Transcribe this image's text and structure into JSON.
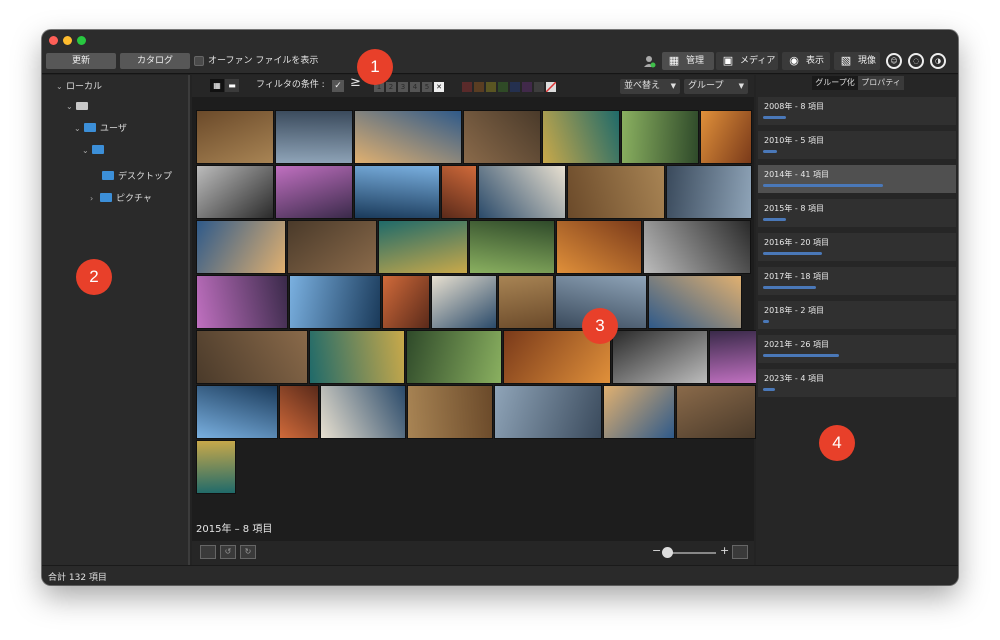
{
  "toolbar": {
    "update_label": "更新",
    "catalog_label": "カタログ",
    "show_orphan_label": "オーファン ファイルを表示",
    "modes": [
      {
        "label": "管理",
        "icon": "grid-icon",
        "active": true
      },
      {
        "label": "メディア",
        "icon": "media-icon",
        "active": false
      },
      {
        "label": "表示",
        "icon": "eye-icon",
        "active": false
      },
      {
        "label": "現像",
        "icon": "develop-icon",
        "active": false
      }
    ]
  },
  "sidebar": {
    "items": [
      {
        "label": "ローカル",
        "icon": "none"
      },
      {
        "label": "",
        "icon": "drive-icon"
      },
      {
        "label": "ユーザ",
        "icon": "folder-icon"
      },
      {
        "label": "",
        "icon": "folder-icon"
      },
      {
        "label": "デスクトップ",
        "icon": "folder-icon"
      },
      {
        "label": "ピクチャ",
        "icon": "folder-icon"
      }
    ]
  },
  "filterbar": {
    "filter_label": "フィルタの条件 :",
    "ge_symbol": "≥",
    "ratings": [
      "1",
      "2",
      "3",
      "4",
      "5"
    ],
    "reject_symbol": "✕",
    "sort_label": "並べ替え",
    "group_label": "グループ"
  },
  "color_swatches": [
    "#5a2a2a",
    "#5a3d22",
    "#5a5522",
    "#2f4a26",
    "#24304f",
    "#41294a",
    "#3d3d3d"
  ],
  "main": {
    "group_title": "2015年 – 8 項目"
  },
  "rightpane": {
    "tab_group": "グループ化",
    "tab_props": "プロパティ",
    "years": [
      {
        "label": "2008年 - 8 項目",
        "fraction": 0.19,
        "selected": false
      },
      {
        "label": "2010年 - 5 項目",
        "fraction": 0.12,
        "selected": false
      },
      {
        "label": "2014年 - 41 項目",
        "fraction": 1.0,
        "selected": true
      },
      {
        "label": "2015年 - 8 項目",
        "fraction": 0.19,
        "selected": false
      },
      {
        "label": "2016年 - 20 項目",
        "fraction": 0.49,
        "selected": false
      },
      {
        "label": "2017年 - 18 項目",
        "fraction": 0.44,
        "selected": false
      },
      {
        "label": "2018年 - 2 項目",
        "fraction": 0.05,
        "selected": false
      },
      {
        "label": "2021年 - 26 項目",
        "fraction": 0.63,
        "selected": false
      },
      {
        "label": "2023年 - 4 項目",
        "fraction": 0.1,
        "selected": false
      }
    ]
  },
  "status": {
    "total": "合計 132 項目"
  },
  "callouts": [
    "1",
    "2",
    "3",
    "4"
  ]
}
